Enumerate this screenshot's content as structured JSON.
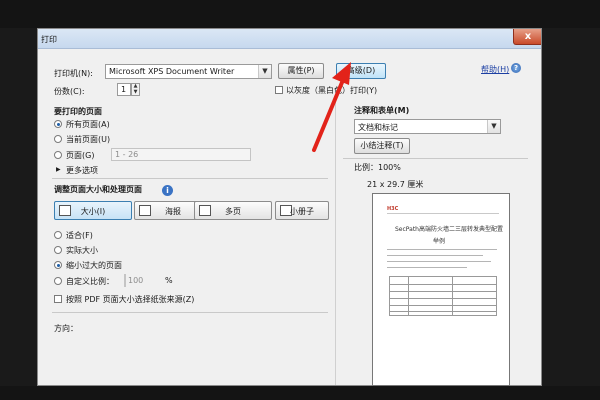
{
  "dialog": {
    "title": "打印",
    "close_label": "x"
  },
  "printer": {
    "label": "打印机(N):",
    "selected": "Microsoft XPS Document Writer",
    "properties_button": "属性(P)",
    "advanced_button": "高级(D)",
    "help_link": "帮助(H)",
    "help_icon": "?"
  },
  "copies": {
    "label": "份数(C):",
    "value": "1",
    "grayscale_label": "以灰度（黑白色）打印(Y)"
  },
  "pages_section": {
    "title": "要打印的页面",
    "options": [
      "所有页面(A)",
      "当前页面(U)",
      "页面(G)"
    ],
    "range_placeholder": "1 - 26",
    "more_options": "更多选项"
  },
  "sizing_section": {
    "title": "调整页面大小和处理页面",
    "info_icon": "i",
    "tiles": [
      "大小(I)",
      "海报",
      "多页",
      "小册子"
    ],
    "options": [
      "适合(F)",
      "实际大小",
      "缩小过大的页面",
      "自定义比例："
    ],
    "custom_scale_value": "100",
    "percent": "%",
    "choose_paper_source": "按照 PDF 页面大小选择纸张来源(Z)"
  },
  "orientation": {
    "title": "方向："
  },
  "comments": {
    "title": "注释和表单(M)",
    "selected": "文档和标记",
    "summarize_button": "小结注释(T)"
  },
  "preview": {
    "scale_text": "比例：100%",
    "size_text": "21 x 29.7 厘米",
    "doc_title": "SecPath高端防火墙二三层转发典型配置",
    "doc_subtitle": "举例"
  },
  "colors": {
    "accent": "#3c7fb1",
    "close": "#c94a2a",
    "arrow": "#e2231a"
  }
}
